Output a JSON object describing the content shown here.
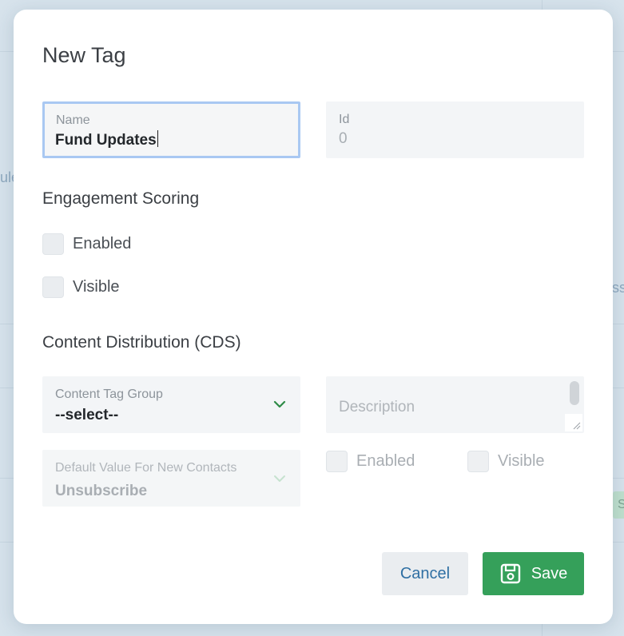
{
  "background": {
    "fragments": [
      "ule",
      "ss",
      "S"
    ]
  },
  "dialog": {
    "title": "New Tag",
    "name_field": {
      "label": "Name",
      "value": "Fund Updates"
    },
    "id_field": {
      "label": "Id",
      "value": "0"
    },
    "engagement_section": {
      "heading": "Engagement Scoring",
      "enabled_label": "Enabled",
      "visible_label": "Visible"
    },
    "cds_section": {
      "heading": "Content Distribution (CDS)",
      "content_tag_group": {
        "label": "Content Tag Group",
        "value": "--select--"
      },
      "default_value": {
        "label": "Default Value For New Contacts",
        "value": "Unsubscribe"
      },
      "description": {
        "placeholder": "Description"
      },
      "enabled_label": "Enabled",
      "visible_label": "Visible"
    },
    "buttons": {
      "cancel": "Cancel",
      "save": "Save"
    }
  },
  "colors": {
    "save_green": "#35a05a",
    "cancel_text": "#2f6fa3",
    "focus_border": "#a9c8f2",
    "chevron_green": "#2e8b47"
  },
  "icons": [
    "chevron-down-icon",
    "save-disk-icon",
    "resize-handle-icon"
  ]
}
